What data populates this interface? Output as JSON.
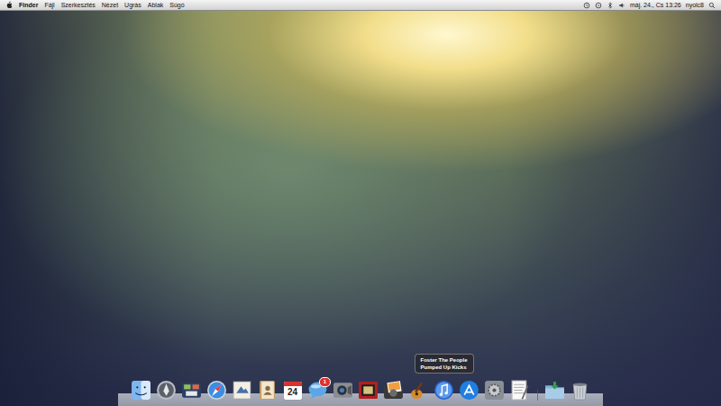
{
  "menubar": {
    "app": "Finder",
    "items": [
      "Fájl",
      "Szerkesztés",
      "Nézet",
      "Ugrás",
      "Ablak",
      "Súgó"
    ],
    "clock": "máj. 24., Cs 13:26",
    "user": "nyolc8"
  },
  "dock": {
    "items": [
      {
        "kind": "finder"
      },
      {
        "kind": "launchpad"
      },
      {
        "kind": "missioncontrol"
      },
      {
        "kind": "safari"
      },
      {
        "kind": "mail"
      },
      {
        "kind": "contacts"
      },
      {
        "kind": "calendar",
        "label": "24"
      },
      {
        "kind": "ichat",
        "badge": "1"
      },
      {
        "kind": "facetime"
      },
      {
        "kind": "photobooth"
      },
      {
        "kind": "iphoto"
      },
      {
        "kind": "garageband"
      },
      {
        "kind": "itunes",
        "tooltip": [
          "Foster The People",
          "Pumped Up Kicks"
        ]
      },
      {
        "kind": "appstore"
      },
      {
        "kind": "sysprefs"
      },
      {
        "kind": "textedit"
      },
      {
        "kind": "separator"
      },
      {
        "kind": "downloads"
      },
      {
        "kind": "trash"
      }
    ]
  }
}
